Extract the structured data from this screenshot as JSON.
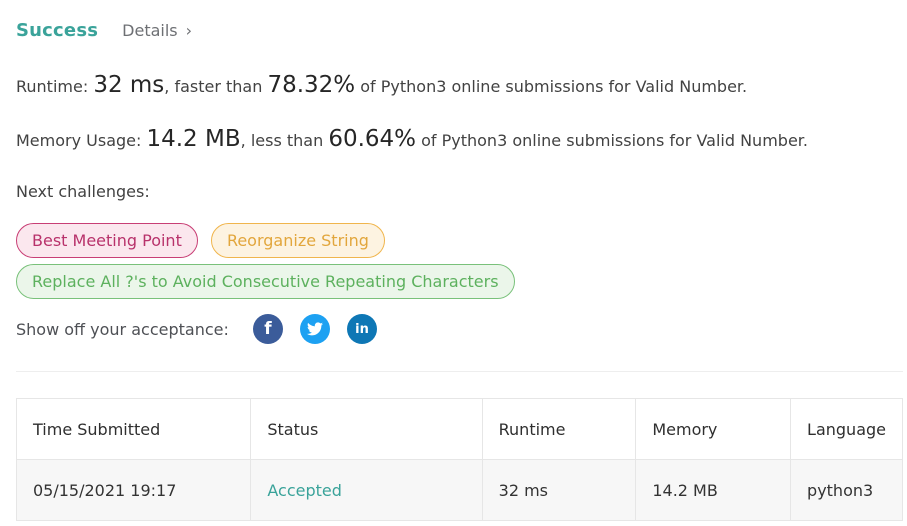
{
  "header": {
    "status": "Success",
    "details_label": "Details",
    "details_chevron": "›"
  },
  "runtime": {
    "label": "Runtime: ",
    "value": "32 ms",
    "middle": ", faster than ",
    "percent": "78.32%",
    "suffix": " of Python3 online submissions for Valid Number."
  },
  "memory": {
    "label": "Memory Usage: ",
    "value": "14.2 MB",
    "middle": ", less than ",
    "percent": "60.64%",
    "suffix": " of Python3 online submissions for Valid Number."
  },
  "next_challenges": {
    "label": "Next challenges:",
    "items": [
      {
        "label": "Best Meeting Point",
        "difficulty_color": "#c83e75"
      },
      {
        "label": "Reorganize String",
        "difficulty_color": "#f0b54c"
      },
      {
        "label": "Replace All ?'s to Avoid Consecutive Repeating Characters",
        "difficulty_color": "#79c17a"
      }
    ]
  },
  "share": {
    "label": "Show off your acceptance:",
    "icons": [
      {
        "name": "facebook-icon",
        "glyph": "f",
        "color": "#3b5c9a"
      },
      {
        "name": "twitter-icon",
        "glyph": "",
        "color": "#1da1f2"
      },
      {
        "name": "linkedin-icon",
        "glyph": "in",
        "color": "#0e77b5"
      }
    ]
  },
  "table": {
    "headers": [
      "Time Submitted",
      "Status",
      "Runtime",
      "Memory",
      "Language"
    ],
    "rows": [
      {
        "time": "05/15/2021 19:17",
        "status": "Accepted",
        "runtime": "32 ms",
        "memory": "14.2 MB",
        "language": "python3"
      }
    ]
  },
  "colors": {
    "accent": "#3aa39a"
  }
}
